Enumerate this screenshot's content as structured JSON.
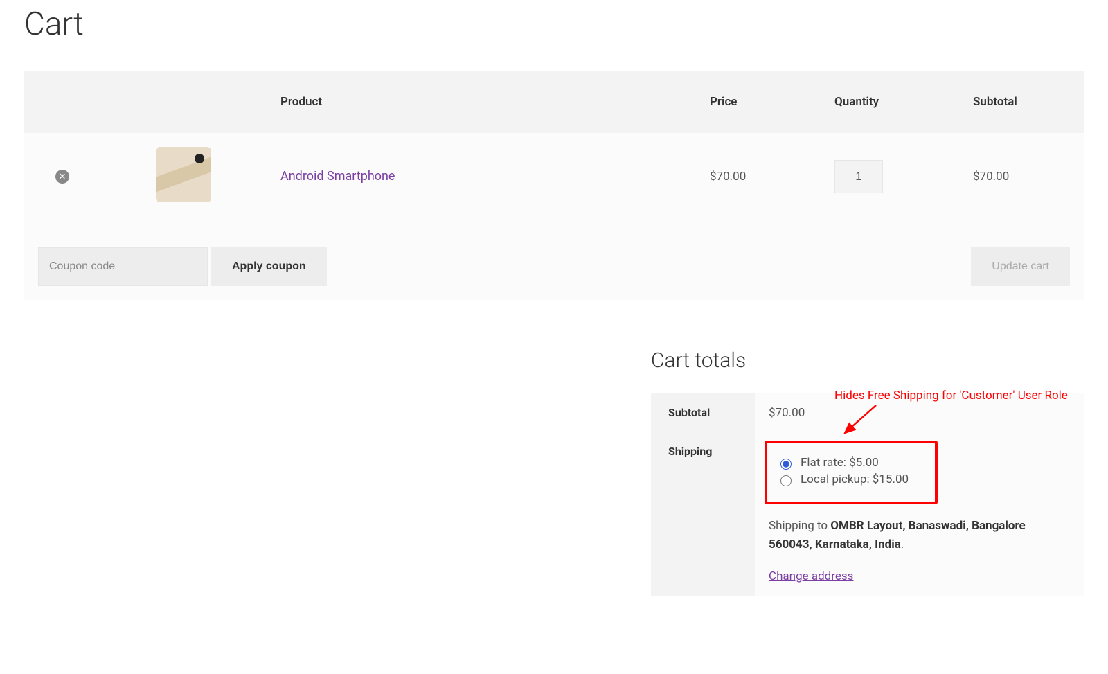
{
  "page_title": "Cart",
  "table": {
    "headers": {
      "product": "Product",
      "price": "Price",
      "quantity": "Quantity",
      "subtotal": "Subtotal"
    },
    "item": {
      "product_name": "Android Smartphone",
      "price": "$70.00",
      "qty": "1",
      "subtotal": "$70.00"
    }
  },
  "actions": {
    "coupon_placeholder": "Coupon code",
    "apply_coupon": "Apply coupon",
    "update_cart": "Update cart"
  },
  "totals": {
    "heading": "Cart totals",
    "subtotal_label": "Subtotal",
    "subtotal_value": "$70.00",
    "shipping_label": "Shipping",
    "options": {
      "flat": "Flat rate: $5.00",
      "local": "Local pickup: $15.00"
    },
    "ship_to_prefix": "Shipping to ",
    "ship_to_address": "OMBR Layout, Banaswadi, Bangalore 560043, Karnataka, India",
    "change_address": "Change address"
  },
  "annotation": "Hides Free Shipping for 'Customer' User Role"
}
